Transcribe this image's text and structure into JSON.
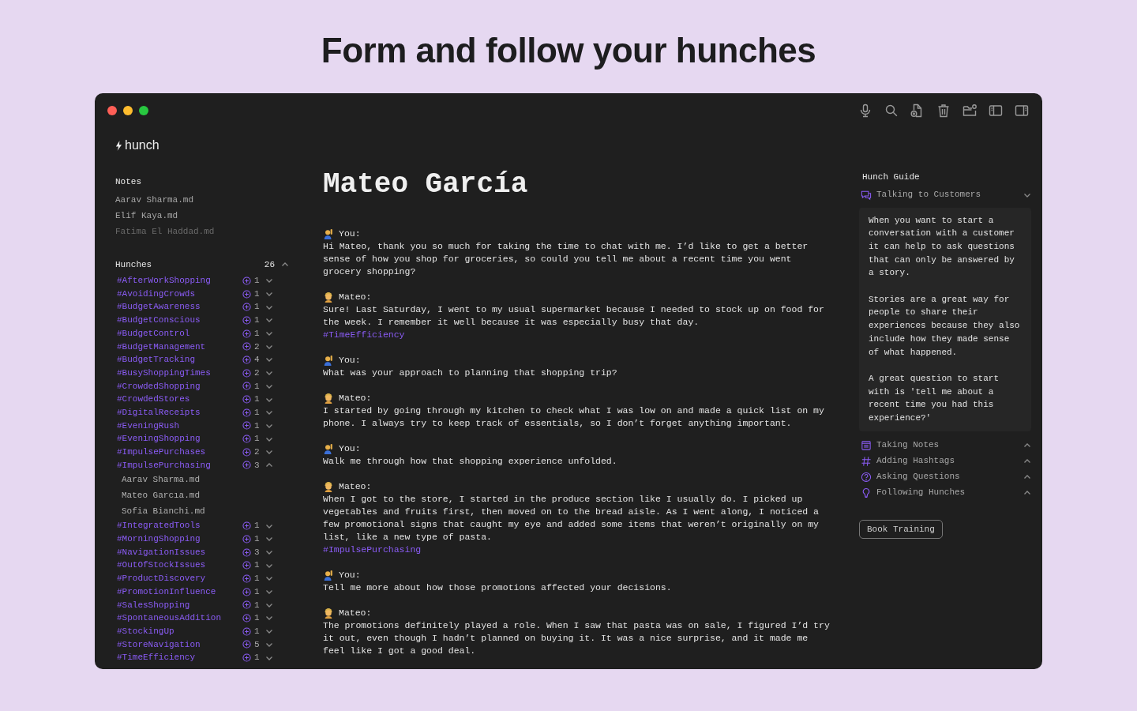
{
  "headline": "Form and follow your hunches",
  "app": {
    "name": "hunch"
  },
  "notes": {
    "title": "Notes",
    "items": [
      {
        "label": "Aarav Sharma.md",
        "dimmed": false
      },
      {
        "label": "Elif Kaya.md",
        "dimmed": false
      },
      {
        "label": "Fatima El Haddad.md",
        "dimmed": true
      }
    ]
  },
  "hunches": {
    "title": "Hunches",
    "count": "26",
    "expanded": true,
    "items": [
      {
        "tag": "#AfterWorkShopping",
        "count": "1",
        "expanded": false
      },
      {
        "tag": "#AvoidingCrowds",
        "count": "1",
        "expanded": false
      },
      {
        "tag": "#BudgetAwareness",
        "count": "1",
        "expanded": false
      },
      {
        "tag": "#BudgetConscious",
        "count": "1",
        "expanded": false
      },
      {
        "tag": "#BudgetControl",
        "count": "1",
        "expanded": false
      },
      {
        "tag": "#BudgetManagement",
        "count": "2",
        "expanded": false
      },
      {
        "tag": "#BudgetTracking",
        "count": "4",
        "expanded": false
      },
      {
        "tag": "#BusyShoppingTimes",
        "count": "2",
        "expanded": false
      },
      {
        "tag": "#CrowdedShopping",
        "count": "1",
        "expanded": false
      },
      {
        "tag": "#CrowdedStores",
        "count": "1",
        "expanded": false
      },
      {
        "tag": "#DigitalReceipts",
        "count": "1",
        "expanded": false
      },
      {
        "tag": "#EveningRush",
        "count": "1",
        "expanded": false
      },
      {
        "tag": "#EveningShopping",
        "count": "1",
        "expanded": false
      },
      {
        "tag": "#ImpulsePurchases",
        "count": "2",
        "expanded": false
      },
      {
        "tag": "#ImpulsePurchasing",
        "count": "3",
        "expanded": true,
        "notes": [
          "Aarav Sharma.md",
          "Mateo Garcıa.md",
          "Sofia Bianchi.md"
        ]
      },
      {
        "tag": "#IntegratedTools",
        "count": "1",
        "expanded": false
      },
      {
        "tag": "#MorningShopping",
        "count": "1",
        "expanded": false
      },
      {
        "tag": "#NavigationIssues",
        "count": "3",
        "expanded": false
      },
      {
        "tag": "#OutOfStockIssues",
        "count": "1",
        "expanded": false
      },
      {
        "tag": "#ProductDiscovery",
        "count": "1",
        "expanded": false
      },
      {
        "tag": "#PromotionInfluence",
        "count": "1",
        "expanded": false
      },
      {
        "tag": "#SalesShopping",
        "count": "1",
        "expanded": false
      },
      {
        "tag": "#SpontaneousAddition",
        "count": "1",
        "expanded": false
      },
      {
        "tag": "#StockingUp",
        "count": "1",
        "expanded": false
      },
      {
        "tag": "#StoreNavigation",
        "count": "5",
        "expanded": false
      },
      {
        "tag": "#TimeEfficiency",
        "count": "1",
        "expanded": false
      }
    ]
  },
  "document": {
    "title": "Mateo García",
    "messages": [
      {
        "kind": "you",
        "speaker": "You:",
        "text": "Hi Mateo, thank you so much for taking the time to chat with me. I’d like to get a better sense of how you shop for groceries, so could you tell me about a recent time you went grocery shopping?"
      },
      {
        "kind": "mateo",
        "speaker": "Mateo:",
        "text": "Sure! Last Saturday, I went to my usual supermarket because I needed to stock up on food for the week. I remember it well because it was especially busy that day.",
        "hashtag": "#TimeEfficiency"
      },
      {
        "kind": "you",
        "speaker": "You:",
        "text": "What was your approach to planning that shopping trip?"
      },
      {
        "kind": "mateo",
        "speaker": "Mateo:",
        "text": "I started by going through my kitchen to check what I was low on and made a quick list on my phone. I always try to keep track of essentials, so I don’t forget anything important."
      },
      {
        "kind": "you",
        "speaker": "You:",
        "text": "Walk me through how that shopping experience unfolded."
      },
      {
        "kind": "mateo",
        "speaker": "Mateo:",
        "text": "When I got to the store, I started in the produce section like I usually do. I picked up vegetables and fruits first, then moved on to the bread aisle. As I went along, I noticed a few promotional signs that caught my eye and added some items that weren’t originally on my list, like a new type of pasta.",
        "hashtag": "#ImpulsePurchasing"
      },
      {
        "kind": "you",
        "speaker": "You:",
        "text": "Tell me more about how those promotions affected your decisions."
      },
      {
        "kind": "mateo",
        "speaker": "Mateo:",
        "text": "The promotions definitely played a role. When I saw that pasta was on sale, I figured I’d try it out, even though I hadn’t planned on buying it. It was a nice surprise, and it made me feel like I got a good deal."
      }
    ]
  },
  "guide": {
    "title": "Hunch Guide",
    "sections": [
      {
        "kind": "chat",
        "label": "Talking to Customers",
        "expanded": true,
        "paragraphs": [
          "When you want to start a conversation with a customer it can help to ask questions that can only be answered by a story.",
          "Stories are a great way for people to share their experiences because they also include how they made sense of what happened.",
          "A great question to start with is 'tell me about a recent time you had this experience?'"
        ]
      },
      {
        "kind": "notes",
        "label": "Taking Notes",
        "expanded": false
      },
      {
        "kind": "hashtag",
        "label": "Adding Hashtags",
        "expanded": false
      },
      {
        "kind": "question",
        "label": "Asking Questions",
        "expanded": false
      },
      {
        "kind": "bulb",
        "label": "Following Hunches",
        "expanded": false
      }
    ],
    "button": "Book Training"
  }
}
